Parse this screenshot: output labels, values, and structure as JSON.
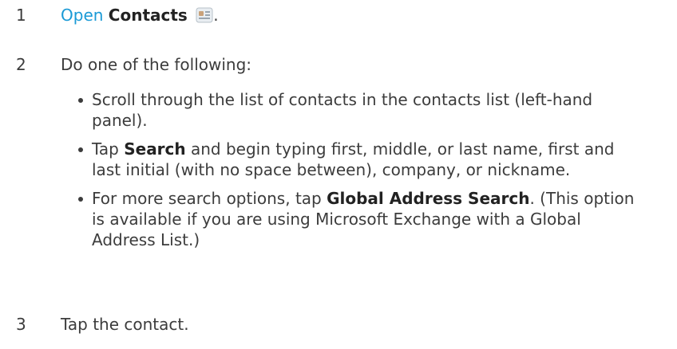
{
  "steps": [
    {
      "number": "1",
      "link": "Open",
      "bold": "Contacts",
      "icon": "contacts-app-icon",
      "tail": "."
    },
    {
      "number": "2",
      "text": "Do one of the following:"
    },
    {
      "number": "3",
      "text": "Tap the contact."
    }
  ],
  "bullets": [
    {
      "lines": [
        "Scroll through the list of contacts in the contacts list (left-hand",
        "panel)."
      ]
    },
    {
      "pre": "Tap ",
      "bold": "Search",
      "mid": " and begin typing first, middle, or last name, first and",
      "line2": "last initial (with no space between), company, or nickname."
    },
    {
      "pre": "For more search options, tap ",
      "bold": "Global Address Search",
      "mid": ". (This option",
      "line2": "is available if you are using Microsoft Exchange with a Global",
      "line3": "Address List.)"
    }
  ],
  "colors": {
    "link": "#1a9ad6",
    "text": "#3c3c3c"
  }
}
